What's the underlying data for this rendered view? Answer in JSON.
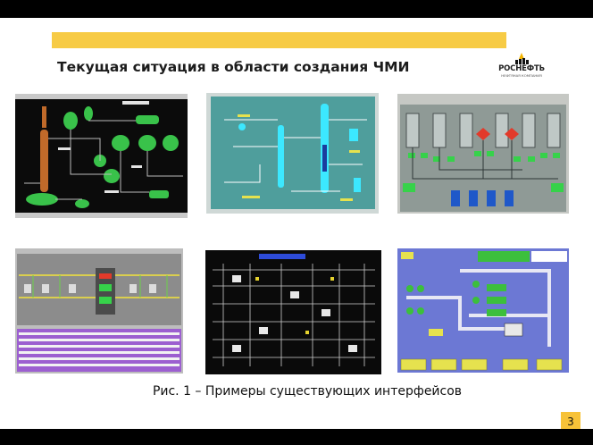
{
  "slide": {
    "title": "Текущая ситуация в области создания ЧМИ",
    "caption": "Рис. 1 – Примеры существующих интерфейсов",
    "page_number": "3"
  },
  "logo": {
    "name": "РОСНЕФТЬ",
    "subtitle": "НЕФТЯНАЯ КОМПАНИЯ"
  },
  "screenshots": [
    {
      "name": "hmi-column-green"
    },
    {
      "name": "hmi-column-cyan"
    },
    {
      "name": "hmi-reactor-grid"
    },
    {
      "name": "hmi-pipeline-table"
    },
    {
      "name": "hmi-dark-mimic"
    },
    {
      "name": "hmi-blue-conveyor"
    }
  ],
  "colors": {
    "accent_yellow": "#f7cb45",
    "logo_yellow": "#f4b400",
    "logo_black": "#111111"
  }
}
